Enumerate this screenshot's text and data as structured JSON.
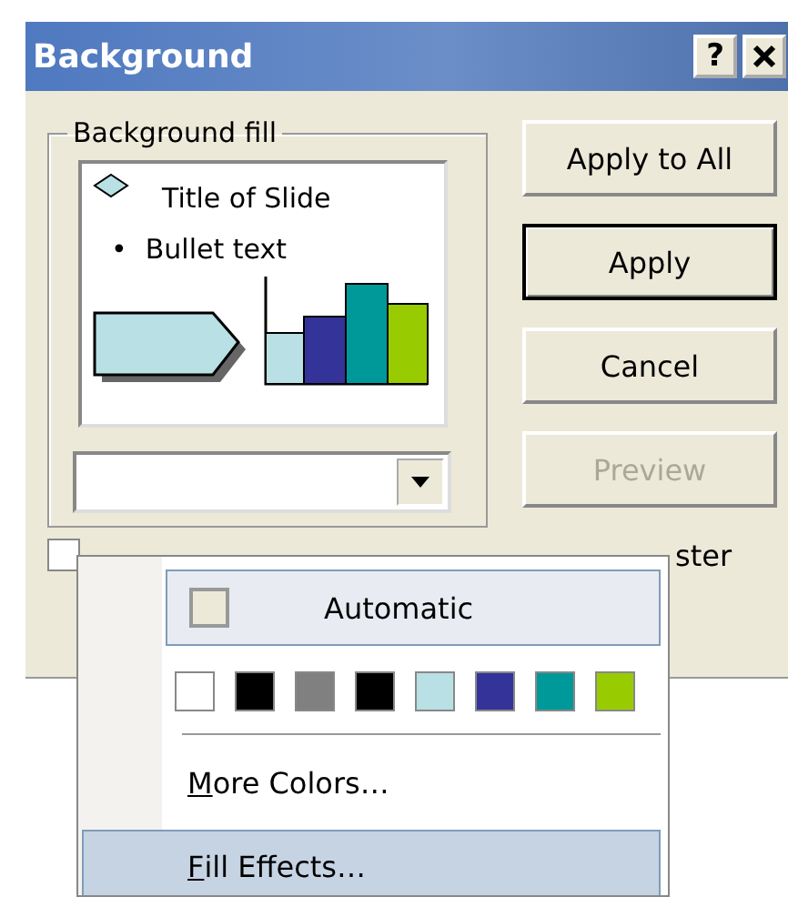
{
  "window": {
    "title": "Background",
    "help_button": "?"
  },
  "background_fill": {
    "label": "Background fill",
    "preview": {
      "title": "Title of Slide",
      "bullet": "•",
      "bullet_text": "Bullet text"
    },
    "color_dropdown": {
      "expanded": true
    }
  },
  "buttons": [
    {
      "label": "Apply to All",
      "default": false,
      "disabled": false
    },
    {
      "label": "Apply",
      "default": true,
      "disabled": false
    },
    {
      "label": "Cancel",
      "default": false,
      "disabled": false
    },
    {
      "label": "Preview",
      "default": false,
      "disabled": true
    }
  ],
  "omit_checkbox": {
    "label": "ster",
    "checked": false
  },
  "color_menu": {
    "automatic": {
      "label": "Automatic",
      "selected": true
    },
    "swatches": [
      {
        "color": "#ffffff"
      },
      {
        "color": "#000000"
      },
      {
        "color": "#808080"
      },
      {
        "color": "#000000"
      },
      {
        "color": "#b9e0e4"
      },
      {
        "color": "#333399"
      },
      {
        "color": "#009999"
      },
      {
        "color": "#99cc00"
      }
    ],
    "items": [
      {
        "label": "More Colors…",
        "first_letter_underlined": true,
        "selected": false
      },
      {
        "label": "Fill Effects…",
        "first_letter_underlined": true,
        "selected": true
      }
    ]
  }
}
